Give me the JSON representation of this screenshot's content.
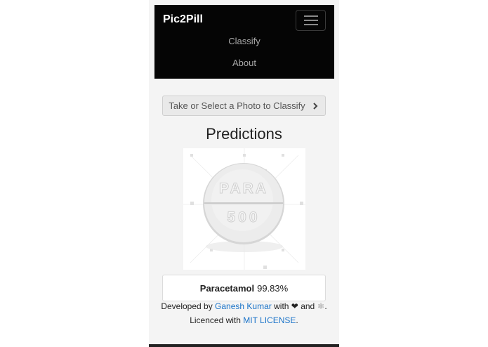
{
  "navbar": {
    "brand": "Pic2Pill",
    "links": [
      "Classify",
      "About"
    ]
  },
  "actions": {
    "select_photo_label": "Take or Select a Photo to Classify"
  },
  "predictions": {
    "heading": "Predictions",
    "image_text_line1": "PARA",
    "image_text_line2": "500",
    "top_label": "Paracetamol",
    "top_confidence": "99.83%"
  },
  "footer": {
    "developed_by": "Developed by",
    "author": "Ganesh Kumar",
    "with": "with",
    "heart": "❤",
    "and": "and",
    "react_icon": "⚛",
    "period": ".",
    "licenced_with": "Licenced with",
    "license": "MIT LICENSE"
  },
  "colors": {
    "navbar_bg": "#050505",
    "link": "#1a73c8",
    "page_bg": "#f4f4f4"
  }
}
